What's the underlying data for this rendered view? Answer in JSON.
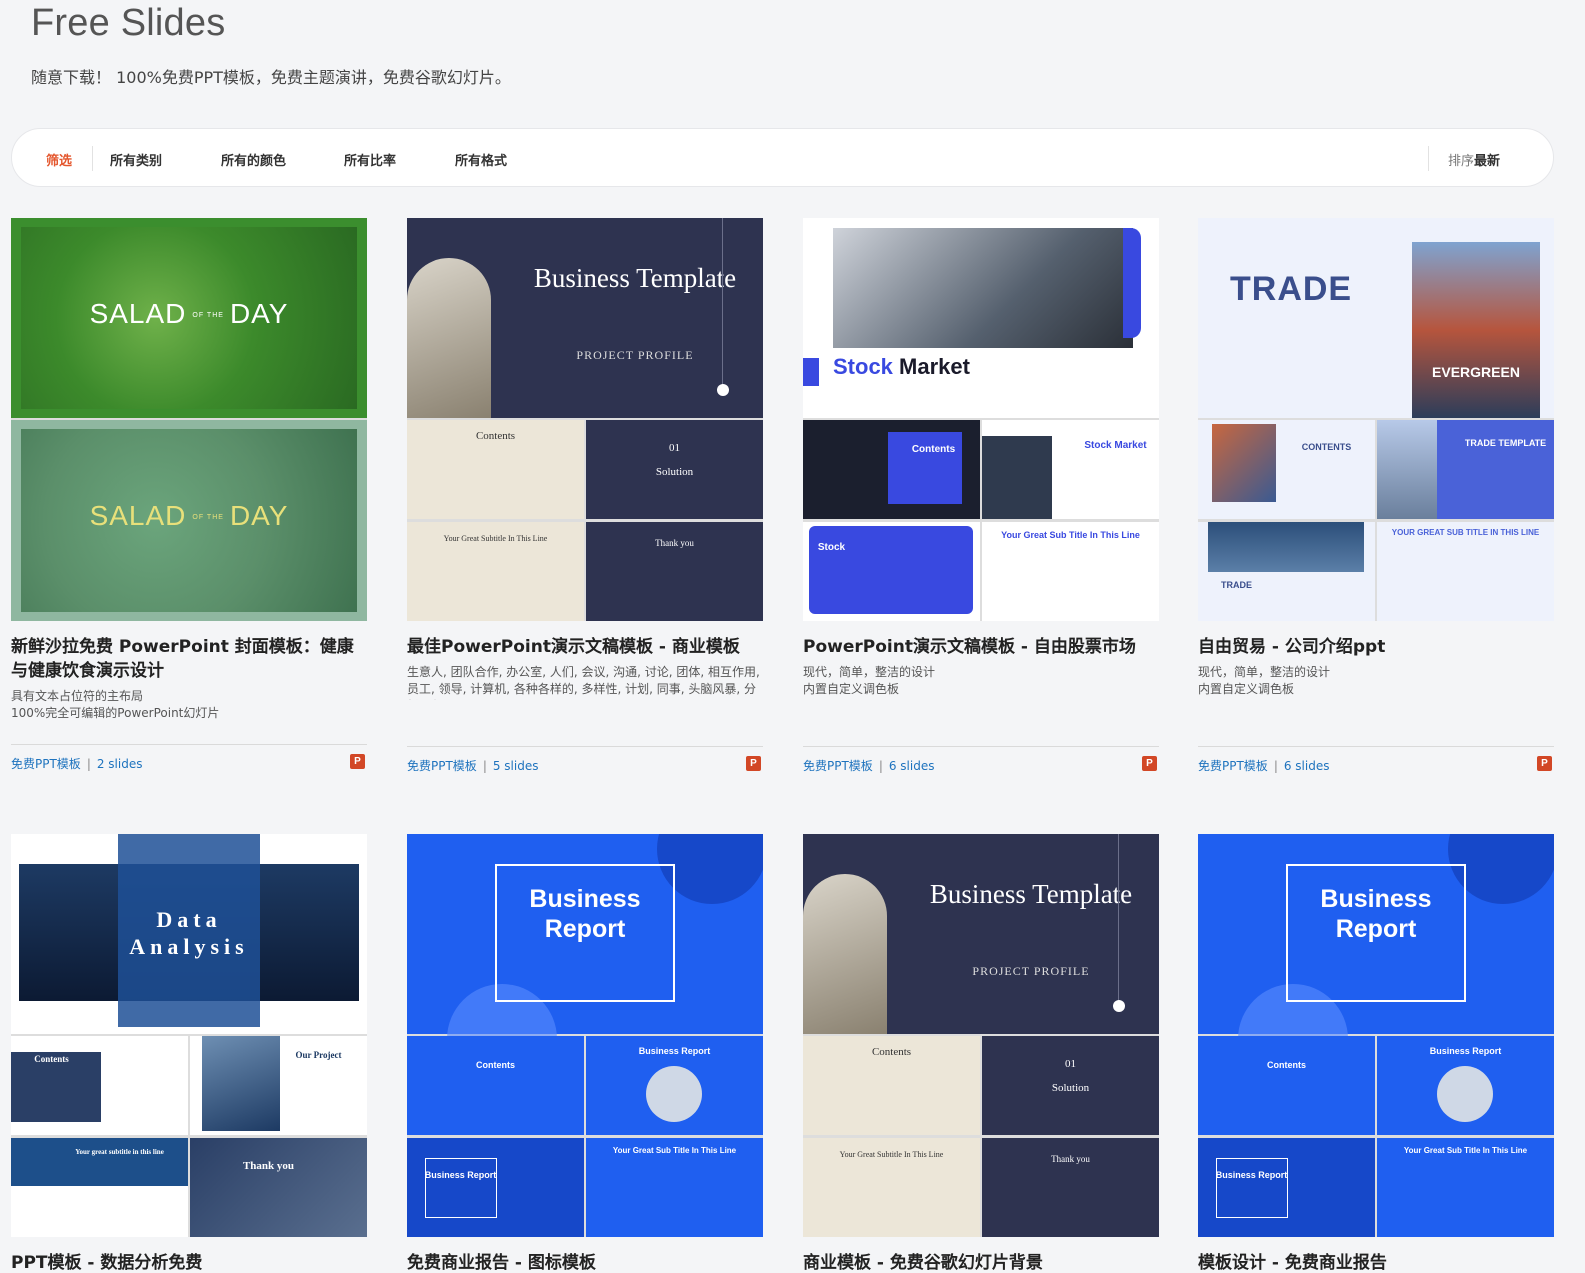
{
  "page": {
    "title": "Free Slides",
    "subtitle": "随意下载！ 100%免费PPT模板，免费主题演讲，免费谷歌幻灯片。"
  },
  "filters": {
    "label": "筛选",
    "items": [
      "所有类别",
      "所有的颜色",
      "所有比率",
      "所有格式"
    ],
    "sort_label": "排序",
    "sort_value": "最新"
  },
  "cards": [
    {
      "title": "新鲜沙拉免费 PowerPoint 封面模板：健康与健康饮食演示设计",
      "desc": "具有文本占位符的主布局\n100%完全可编辑的PowerPoint幻灯片",
      "category": "免费PPT模板",
      "count": "2 slides",
      "thumb": {
        "main_text": "SALAD",
        "of_the": "OF THE",
        "main_text2": "DAY"
      }
    },
    {
      "title": "最佳PowerPoint演示文稿模板 - 商业模板",
      "desc": "生意人, 团队合作, 办公室, 人们, 会议, 沟通, 讨论, 团体, 相互作用, 员工, 领导, 计算机, 各种各样的, 多样性, 计划, 同事, 头脑风暴, 分析, 随",
      "category": "免费PPT模板",
      "count": "5 slides",
      "thumb": {
        "title": "Business Template",
        "sub": "PROJECT PROFILE",
        "c1": "Contents",
        "c2": "01",
        "c2b": "Solution",
        "c3": "Your Great Subtitle In This Line",
        "c4": "Thank you"
      }
    },
    {
      "title": "PowerPoint演示文稿模板 - 自由股票市场",
      "desc": "现代，简单，整洁的设计\n内置自定义调色板",
      "category": "免费PPT模板",
      "count": "6 slides",
      "thumb": {
        "title_a": "Stock ",
        "title_b": "Market",
        "c1": "Contents",
        "c2": "Stock Market",
        "c3": "Stock",
        "c4": "Your Great Sub Title In This Line"
      }
    },
    {
      "title": "自由贸易 - 公司介绍ppt",
      "desc": "现代，简单，整洁的设计\n内置自定义调色板",
      "category": "免费PPT模板",
      "count": "6 slides",
      "thumb": {
        "title": "TRADE",
        "photo_text": "EVERGREEN",
        "c1": "CONTENTS",
        "c2": "TRADE TEMPLATE",
        "c3": "TRADE",
        "c4": "YOUR GREAT SUB TITLE IN THIS LINE"
      }
    },
    {
      "title": "PPT模板 - 数据分析免费",
      "thumb": {
        "title": "Data Analysis",
        "c1": "Contents",
        "c2": "Our Project",
        "c3": "Your great subtitle in this line",
        "c4": "Thank you"
      }
    },
    {
      "title": "免费商业报告 - 图标模板",
      "thumb": {
        "title": "Business Report",
        "c1": "Contents",
        "c2": "Business Report",
        "c3": "Business Report",
        "c4": "Your Great Sub Title In This Line"
      }
    },
    {
      "title": "商业模板 - 免费谷歌幻灯片背景",
      "thumb": {
        "title": "Business Template",
        "sub": "PROJECT PROFILE",
        "c1": "Contents",
        "c2": "01",
        "c2b": "Solution",
        "c3": "Your Great Subtitle In This Line",
        "c4": "Thank you"
      }
    },
    {
      "title": "模板设计 - 免费商业报告",
      "thumb": {
        "title": "Business Report",
        "c1": "Contents",
        "c2": "Business Report",
        "c3": "Business Report",
        "c4": "Your Great Sub Title In This Line"
      }
    }
  ],
  "icons": {
    "format_badge": "P"
  },
  "colors": {
    "accent": "#e4572e",
    "link": "#1e73be",
    "ppt": "#d24726"
  }
}
